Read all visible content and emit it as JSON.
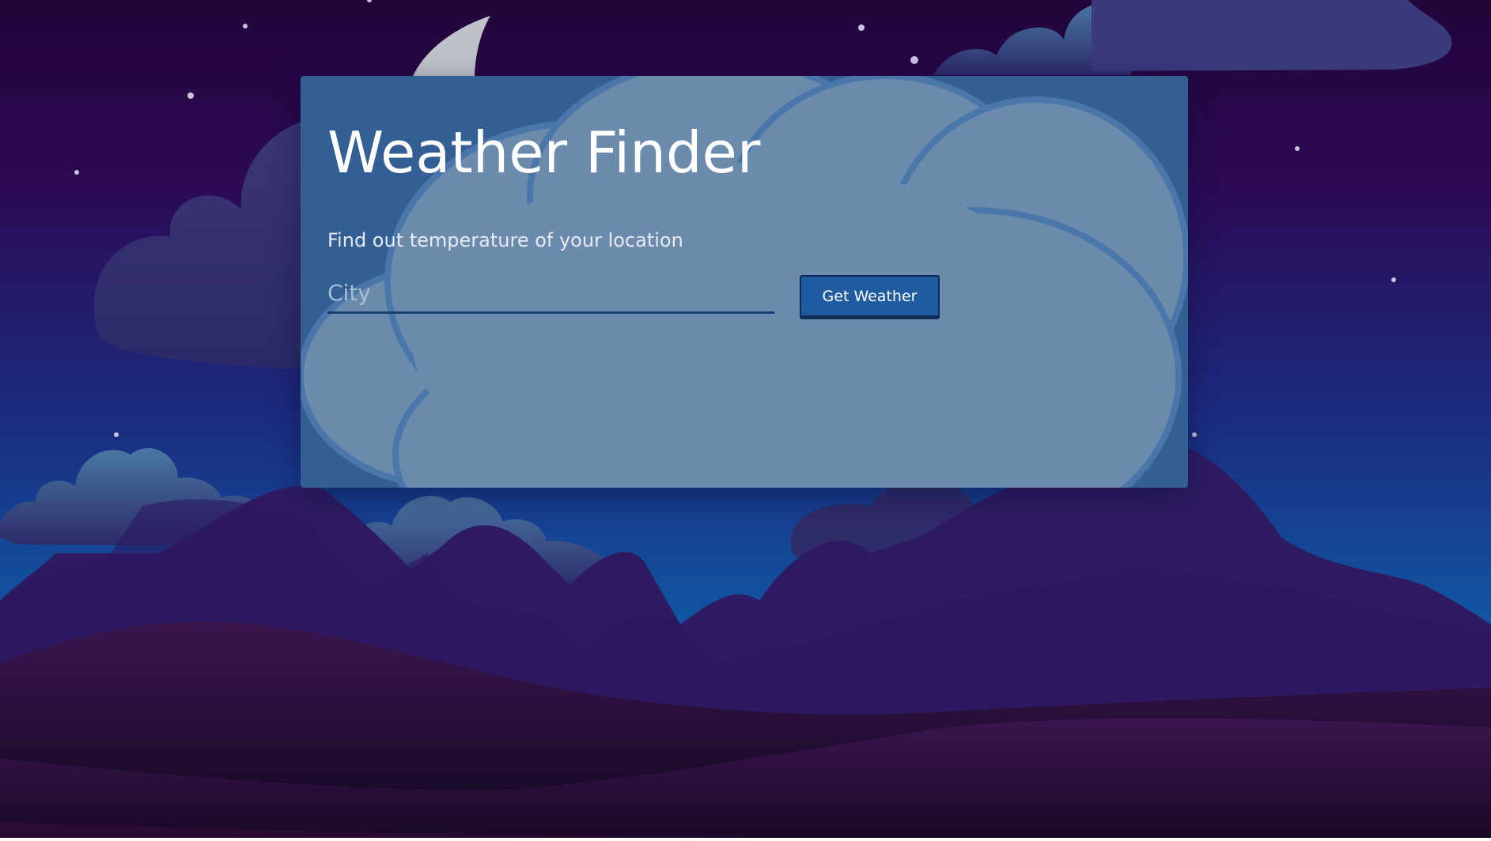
{
  "app": {
    "title": "Weather Finder",
    "subtitle": "Find out temperature of your location"
  },
  "search": {
    "placeholder": "City",
    "value": ""
  },
  "actions": {
    "get_weather_label": "Get Weather"
  },
  "colors": {
    "sky_top": "#22053a",
    "sky_bottom": "#0d64ad",
    "panel": "#335f95",
    "panel_cloud": "#6b8aac",
    "button": "#1f5b9e",
    "input_underline": "#17406e",
    "mountains": "#2f1b63",
    "hills": "#150b28"
  },
  "icons": [
    "moon-icon",
    "star-icon",
    "cloud-icon",
    "mountain-icon"
  ]
}
